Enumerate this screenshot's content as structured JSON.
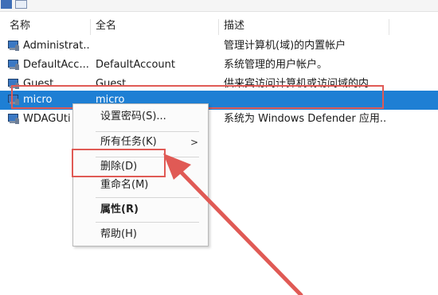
{
  "toolbar": {
    "icons": [
      "help-icon",
      "show-hide-pane-icon"
    ]
  },
  "columns": [
    "名称",
    "全名",
    "描述"
  ],
  "users": [
    {
      "name": "Administrat...",
      "full_name": "",
      "description": "管理计算机(域)的内置帐户",
      "icon": "user-account-icon"
    },
    {
      "name": "DefaultAcc...",
      "full_name": "DefaultAccount",
      "description": "系统管理的用户帐户。",
      "icon": "user-account-icon"
    },
    {
      "name": "Guest",
      "full_name": "Guest",
      "description": "供来宾访问计算机或访问域的内...",
      "icon": "user-account-icon"
    },
    {
      "name": "micro",
      "full_name": "micro",
      "description": "",
      "icon": "user-account-icon",
      "selected": true
    },
    {
      "name": "WDAGUti",
      "full_name": "",
      "description": "系统为 Windows Defender 应用...",
      "icon": "user-account-icon"
    }
  ],
  "context_menu": {
    "set_password": "设置密码(S)...",
    "all_tasks": "所有任务(K)",
    "all_tasks_arrow": ">",
    "delete": "删除(D)",
    "rename": "重命名(M)",
    "properties": "属性(R)",
    "help": "帮助(H)"
  },
  "annotation": {
    "color": "#e05a55"
  },
  "colors": {
    "selection": "#1e7fd4"
  }
}
